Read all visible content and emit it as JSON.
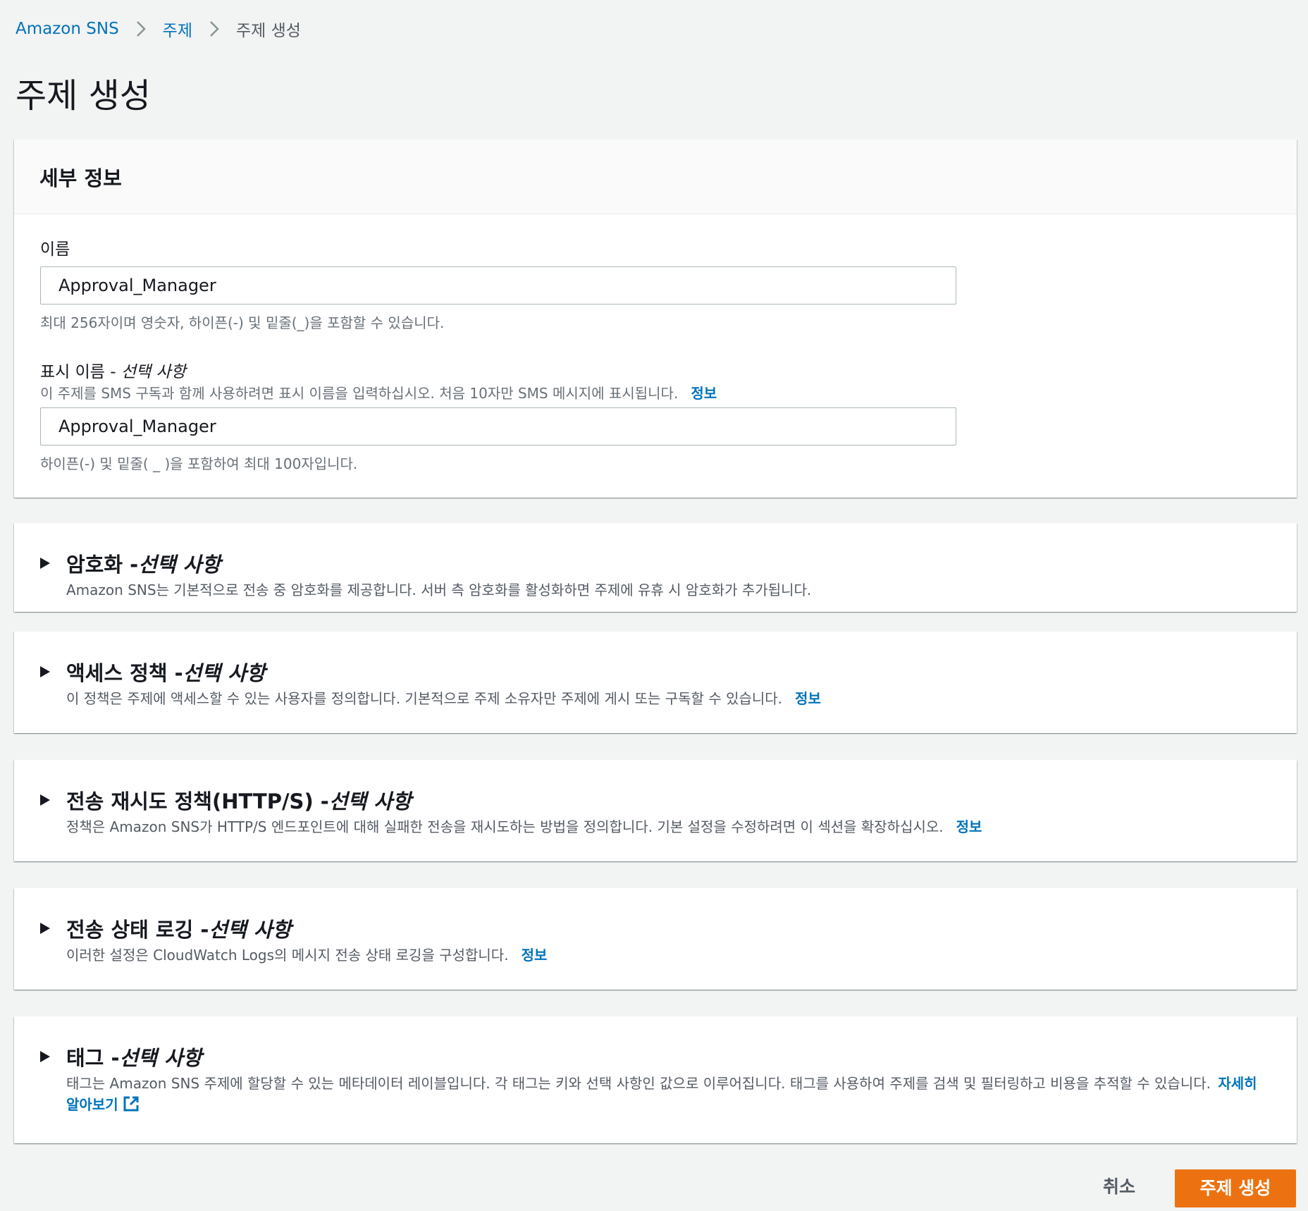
{
  "breadcrumb": {
    "items": [
      "Amazon SNS",
      "주제",
      "주제 생성"
    ]
  },
  "page": {
    "title": "주제 생성"
  },
  "details": {
    "header": "세부 정보",
    "name_label": "이름",
    "name_value": "Approval_Manager",
    "name_hint": "최대 256자이며 영숫자, 하이픈(-) 및 밑줄(_)을 포함할 수 있습니다.",
    "display_label": "표시 이름 - ",
    "display_label_optional": "선택 사항",
    "display_desc": "이 주제를 SMS 구독과 함께 사용하려면 표시 이름을 입력하십시오. 처음 10자만 SMS 메시지에 표시됩니다.",
    "display_info": "정보",
    "display_value": "Approval_Manager",
    "display_hint": "하이픈(-) 및 밑줄( _ )을 포함하여 최대 100자입니다."
  },
  "sections": [
    {
      "title": "암호화 - ",
      "optional": "선택 사항",
      "desc": "Amazon SNS는 기본적으로 전송 중 암호화를 제공합니다. 서버 측 암호화를 활성화하면 주제에 유휴 시 암호화가 추가됩니다.",
      "info": ""
    },
    {
      "title": "액세스 정책 - ",
      "optional": "선택 사항",
      "desc": "이 정책은 주제에 액세스할 수 있는 사용자를 정의합니다. 기본적으로 주제 소유자만 주제에 게시 또는 구독할 수 있습니다.",
      "info": "정보"
    },
    {
      "title": "전송 재시도 정책(HTTP/S) - ",
      "optional": "선택 사항",
      "desc": "정책은 Amazon SNS가 HTTP/S 엔드포인트에 대해 실패한 전송을 재시도하는 방법을 정의합니다. 기본 설정을 수정하려면 이 섹션을 확장하십시오.",
      "info": "정보"
    },
    {
      "title": "전송 상태 로깅 - ",
      "optional": "선택 사항",
      "desc": "이러한 설정은 CloudWatch Logs의 메시지 전송 상태 로깅을 구성합니다.",
      "info": "정보"
    },
    {
      "title": "태그 - ",
      "optional": "선택 사항",
      "desc": "태그는 Amazon SNS 주제에 할당할 수 있는 메타데이터 레이블입니다. 각 태그는 키와 선택 사항인 값으로 이루어집니다. 태그를 사용하여 주제를 검색 및 필터링하고 비용을 추적할 수 있습니다.",
      "learn_more": "자세히 알아보기"
    }
  ],
  "actions": {
    "cancel": "취소",
    "submit": "주제 생성"
  },
  "colors": {
    "link": "#0073bb",
    "primary": "#ec7211",
    "background": "#f2f3f3"
  }
}
